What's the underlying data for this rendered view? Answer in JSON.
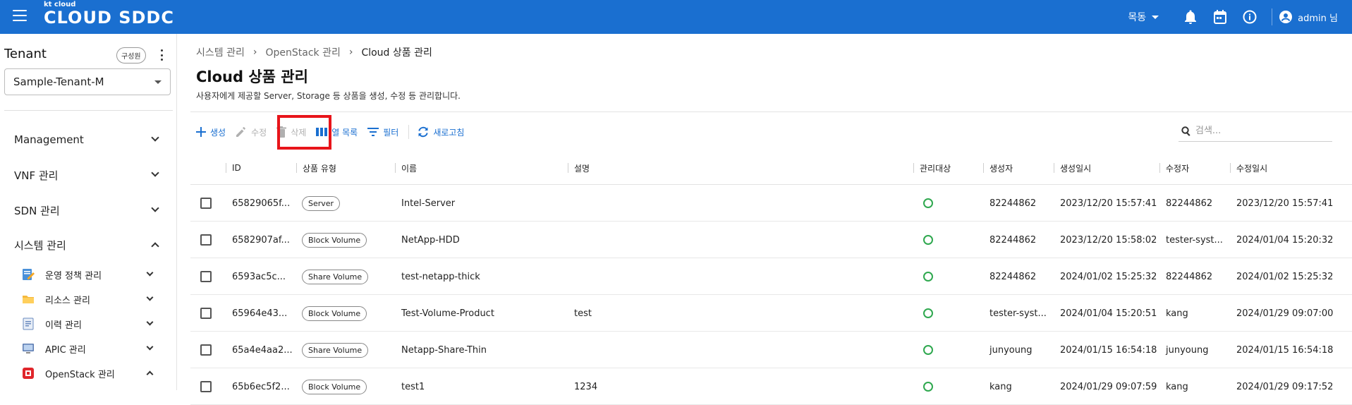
{
  "topbar": {
    "logo_small": "kt cloud",
    "logo_big": "CLOUD SDDC",
    "region": "목동",
    "user": "admin 님"
  },
  "sidebar": {
    "tenant_label": "Tenant",
    "member_badge": "구성원",
    "tenant_select": "Sample-Tenant-M",
    "menu": [
      {
        "label": "Management"
      },
      {
        "label": "VNF 관리"
      },
      {
        "label": "SDN 관리"
      },
      {
        "label": "시스템 관리"
      }
    ],
    "sub": [
      {
        "label": "운영 정책 관리",
        "icon": "policy-icon"
      },
      {
        "label": "리소스 관리",
        "icon": "folder-icon"
      },
      {
        "label": "이력 관리",
        "icon": "history-icon"
      },
      {
        "label": "APIC 관리",
        "icon": "monitor-icon"
      },
      {
        "label": "OpenStack 관리",
        "icon": "openstack-icon"
      }
    ]
  },
  "breadcrumb": {
    "items": [
      "시스템 관리",
      "OpenStack 관리",
      "Cloud 상품 관리"
    ]
  },
  "page": {
    "title": "Cloud 상품 관리",
    "description": "사용자에게 제공할 Server, Storage 등 상품을 생성, 수정 등 관리합니다."
  },
  "toolbar": {
    "create": "생성",
    "edit": "수정",
    "delete": "삭제",
    "columns": "열 목록",
    "filter": "필터",
    "refresh": "새로고침"
  },
  "search": {
    "placeholder": "검색..."
  },
  "table": {
    "columns": [
      "ID",
      "상품 유형",
      "이름",
      "설명",
      "관리대상",
      "생성자",
      "생성일시",
      "수정자",
      "수정일시"
    ],
    "rows": [
      {
        "id": "65829065f...",
        "type": "Server",
        "name": "Intel-Server",
        "desc": "",
        "creator": "82244862",
        "created": "2023/12/20 15:57:41",
        "modifier": "82244862",
        "modified": "2023/12/20 15:57:41"
      },
      {
        "id": "6582907af...",
        "type": "Block Volume",
        "name": "NetApp-HDD",
        "desc": "",
        "creator": "82244862",
        "created": "2023/12/20 15:58:02",
        "modifier": "tester-syst...",
        "modified": "2024/01/04 15:20:32"
      },
      {
        "id": "6593ac5c...",
        "type": "Share Volume",
        "name": "test-netapp-thick",
        "desc": "",
        "creator": "82244862",
        "created": "2024/01/02 15:25:32",
        "modifier": "82244862",
        "modified": "2024/01/02 15:25:32"
      },
      {
        "id": "65964e43...",
        "type": "Block Volume",
        "name": "Test-Volume-Product",
        "desc": "test",
        "creator": "tester-syst...",
        "created": "2024/01/04 15:20:51",
        "modifier": "kang",
        "modified": "2024/01/29 09:07:00"
      },
      {
        "id": "65a4e4aa2...",
        "type": "Share Volume",
        "name": "Netapp-Share-Thin",
        "desc": "",
        "creator": "junyoung",
        "created": "2024/01/15 16:54:18",
        "modifier": "junyoung",
        "modified": "2024/01/15 16:54:18"
      },
      {
        "id": "65b6ec5f2...",
        "type": "Block Volume",
        "name": "test1",
        "desc": "1234",
        "creator": "kang",
        "created": "2024/01/29 09:07:59",
        "modifier": "kang",
        "modified": "2024/01/29 09:17:52"
      }
    ]
  },
  "colors": {
    "primary": "#1a6fd0",
    "highlight": "#e8141a",
    "status_ok": "#2fa84f"
  }
}
